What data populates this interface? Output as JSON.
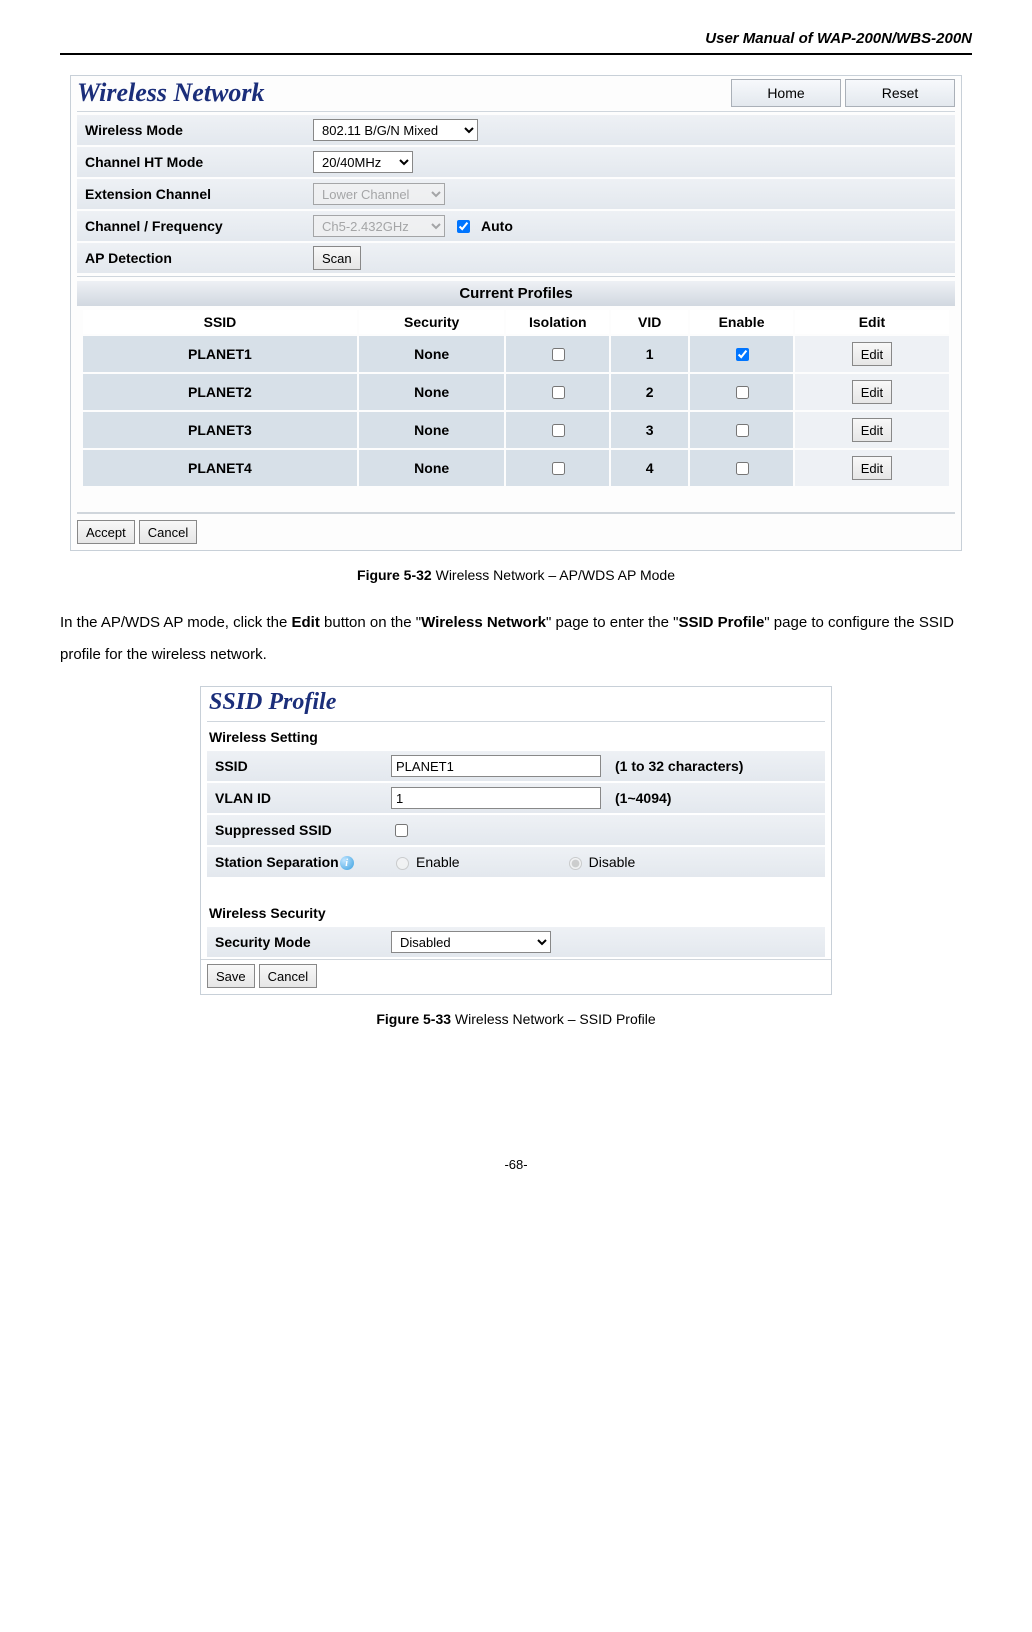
{
  "doc": {
    "header": "User Manual of WAP-200N/WBS-200N",
    "page": "-68-"
  },
  "fig1": {
    "title": "Wireless Network",
    "home_btn": "Home",
    "reset_btn": "Reset",
    "rows": {
      "wmode_label": "Wireless Mode",
      "wmode_value": "802.11 B/G/N Mixed",
      "ht_label": "Channel HT Mode",
      "ht_value": "20/40MHz",
      "ext_label": "Extension Channel",
      "ext_value": "Lower Channel",
      "freq_label": "Channel / Frequency",
      "freq_value": "Ch5-2.432GHz",
      "auto_label": "Auto",
      "apdet_label": "AP Detection",
      "scan_btn": "Scan"
    },
    "profiles_header": "Current Profiles",
    "cols": {
      "ssid": "SSID",
      "security": "Security",
      "isolation": "Isolation",
      "vid": "VID",
      "enable": "Enable",
      "edit": "Edit"
    },
    "edit_btn": "Edit",
    "profiles": [
      {
        "ssid": "PLANET1",
        "security": "None",
        "vid": "1",
        "enabled": true
      },
      {
        "ssid": "PLANET2",
        "security": "None",
        "vid": "2",
        "enabled": false
      },
      {
        "ssid": "PLANET3",
        "security": "None",
        "vid": "3",
        "enabled": false
      },
      {
        "ssid": "PLANET4",
        "security": "None",
        "vid": "4",
        "enabled": false
      }
    ],
    "accept_btn": "Accept",
    "cancel_btn": "Cancel",
    "caption_label": "Figure 5-32",
    "caption_text": " Wireless Network – AP/WDS AP Mode"
  },
  "para": {
    "p1a": "In the AP/WDS AP mode, click the ",
    "p1b": "Edit",
    "p1c": " button on the \"",
    "p1d": "Wireless Network",
    "p1e": "\" page to enter the \"",
    "p1f": "SSID Profile",
    "p1g": "\" page to configure the SSID profile for the wireless network."
  },
  "fig2": {
    "title": "SSID Profile",
    "sec_setting": "Wireless Setting",
    "ssid_label": "SSID",
    "ssid_value": "PLANET1",
    "ssid_hint": "(1 to 32 characters)",
    "vlan_label": "VLAN ID",
    "vlan_value": "1",
    "vlan_hint": "(1~4094)",
    "sup_label": "Suppressed SSID",
    "sep_label": "Station Separation",
    "enable_label": "Enable",
    "disable_label": "Disable",
    "sec_security": "Wireless Security",
    "secmode_label": "Security Mode",
    "secmode_value": "Disabled",
    "save_btn": "Save",
    "cancel_btn": "Cancel",
    "caption_label": "Figure 5-33",
    "caption_text": " Wireless Network – SSID Profile"
  }
}
